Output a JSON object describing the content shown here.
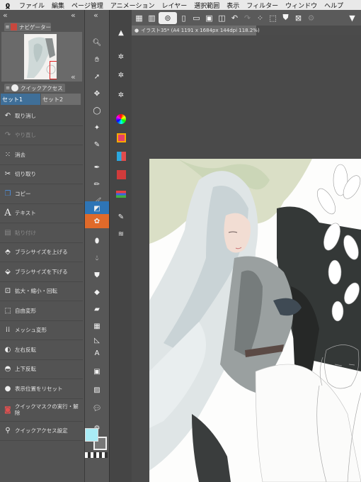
{
  "menubar": {
    "items": [
      "ファイル",
      "編集",
      "ページ管理",
      "アニメーション",
      "レイヤー",
      "選択範囲",
      "表示",
      "フィルター",
      "ウィンドウ",
      "ヘルプ"
    ]
  },
  "navigator": {
    "tab_label": "ナビゲーター"
  },
  "quick_access": {
    "tab_label": "クイックアクセス",
    "set_tabs": [
      "セット1",
      "セット2"
    ],
    "items": [
      {
        "label": "取り消し",
        "icon": "undo-icon",
        "enabled": true
      },
      {
        "label": "やり直し",
        "icon": "redo-icon",
        "enabled": false
      },
      {
        "label": "消去",
        "icon": "erase-icon",
        "enabled": true
      },
      {
        "label": "切り取り",
        "icon": "scissors-icon",
        "enabled": true
      },
      {
        "label": "コピー",
        "icon": "copy-icon",
        "enabled": true
      },
      {
        "label": "テキスト",
        "icon": "text-icon",
        "enabled": true
      },
      {
        "label": "貼り付け",
        "icon": "paste-icon",
        "enabled": false
      },
      {
        "label": "ブラシサイズを上げる",
        "icon": "brush-size-up-icon",
        "enabled": true
      },
      {
        "label": "ブラシサイズを下げる",
        "icon": "brush-size-down-icon",
        "enabled": true
      },
      {
        "label": "拡大・縮小・回転",
        "icon": "transform-icon",
        "enabled": true
      },
      {
        "label": "自由変形",
        "icon": "free-transform-icon",
        "enabled": true
      },
      {
        "label": "メッシュ変形",
        "icon": "mesh-transform-icon",
        "enabled": true
      },
      {
        "label": "左右反転",
        "icon": "flip-horizontal-icon",
        "enabled": true
      },
      {
        "label": "上下反転",
        "icon": "flip-vertical-icon",
        "enabled": true
      },
      {
        "label": "表示位置をリセット",
        "icon": "reset-view-icon",
        "enabled": true
      },
      {
        "label": "クイックマスクの実行・解除",
        "icon": "quick-mask-icon",
        "enabled": true
      },
      {
        "label": "クイックアクセス設定",
        "icon": "settings-icon",
        "enabled": true
      }
    ]
  },
  "canvas": {
    "tab_label": "イラスト35* (A4 1191 x 1684px 144dpi 118.2%)"
  },
  "colors": {
    "main_color": "#a9ecf6",
    "sub_color": "#777777",
    "accent": "#2e75b6"
  }
}
